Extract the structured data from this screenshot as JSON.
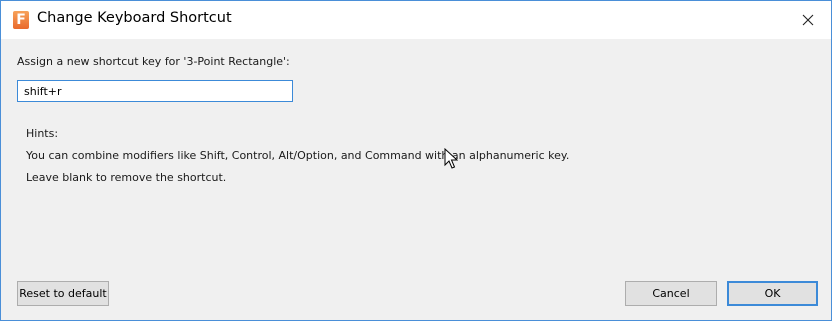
{
  "window": {
    "title": "Change Keyboard Shortcut",
    "icon_letter": "F",
    "app_icon": "app-logo-icon",
    "close_icon": "close-icon",
    "accent_color": "#3c8ad8"
  },
  "form": {
    "prompt": "Assign a new shortcut key for '3-Point Rectangle':",
    "shortcut_value": "shift+r"
  },
  "hints": {
    "heading": "Hints:",
    "line1": "You can combine modifiers like Shift, Control, Alt/Option, and Command with an alphanumeric key.",
    "line2": "Leave blank to remove the shortcut."
  },
  "buttons": {
    "reset": "Reset to default",
    "cancel": "Cancel",
    "ok": "OK"
  },
  "cursor": "mouse-pointer-icon"
}
